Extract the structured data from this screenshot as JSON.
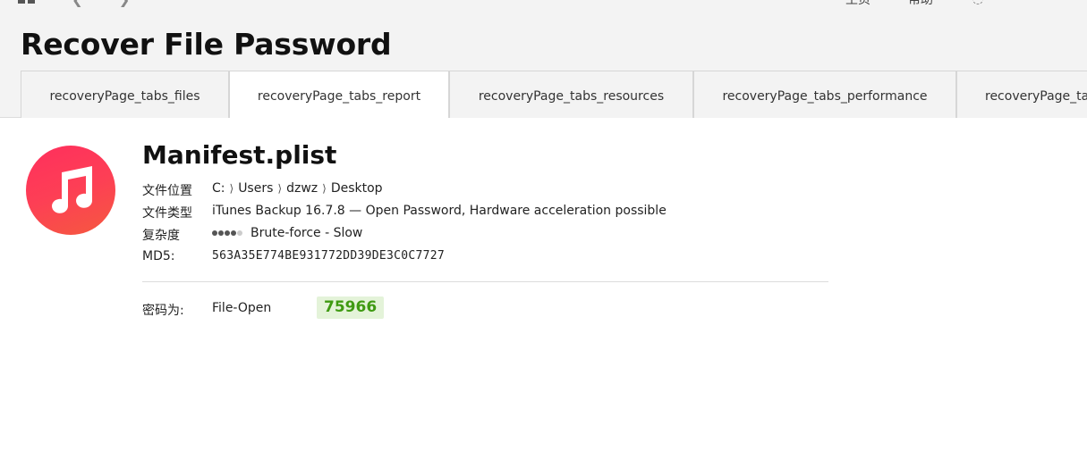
{
  "page": {
    "title": "Recover File Password"
  },
  "toolbar": {
    "item1": "主页",
    "item2": "帮助"
  },
  "tabs": [
    {
      "label": "recoveryPage_tabs_files",
      "active": false
    },
    {
      "label": "recoveryPage_tabs_report",
      "active": true
    },
    {
      "label": "recoveryPage_tabs_resources",
      "active": false
    },
    {
      "label": "recoveryPage_tabs_performance",
      "active": false
    },
    {
      "label": "recoveryPage_tabs_log",
      "active": false
    }
  ],
  "file": {
    "icon": "music-note-icon",
    "name": "Manifest.plist",
    "location_label": "文件位置",
    "location_parts": [
      "C:",
      "Users",
      "dzwz",
      "Desktop"
    ],
    "path_separator": "⟩",
    "type_label": "文件类型",
    "type_value": "iTunes Backup 16.7.8 — Open Password, Hardware acceleration possible",
    "complexity_label": "复杂度",
    "complexity_level": 4,
    "complexity_max": 5,
    "complexity_value": "Brute-force - Slow",
    "md5_label": "MD5:",
    "md5_value": "563A35E774BE931772DD39DE3C0C7727"
  },
  "result": {
    "label": "密码为:",
    "kind": "File-Open",
    "password": "75966"
  },
  "colors": {
    "icon_gradient_start": "#ff2f5d",
    "icon_gradient_end": "#f5593f",
    "password_bg": "#e4f3d9",
    "password_text": "#3f9a12"
  }
}
